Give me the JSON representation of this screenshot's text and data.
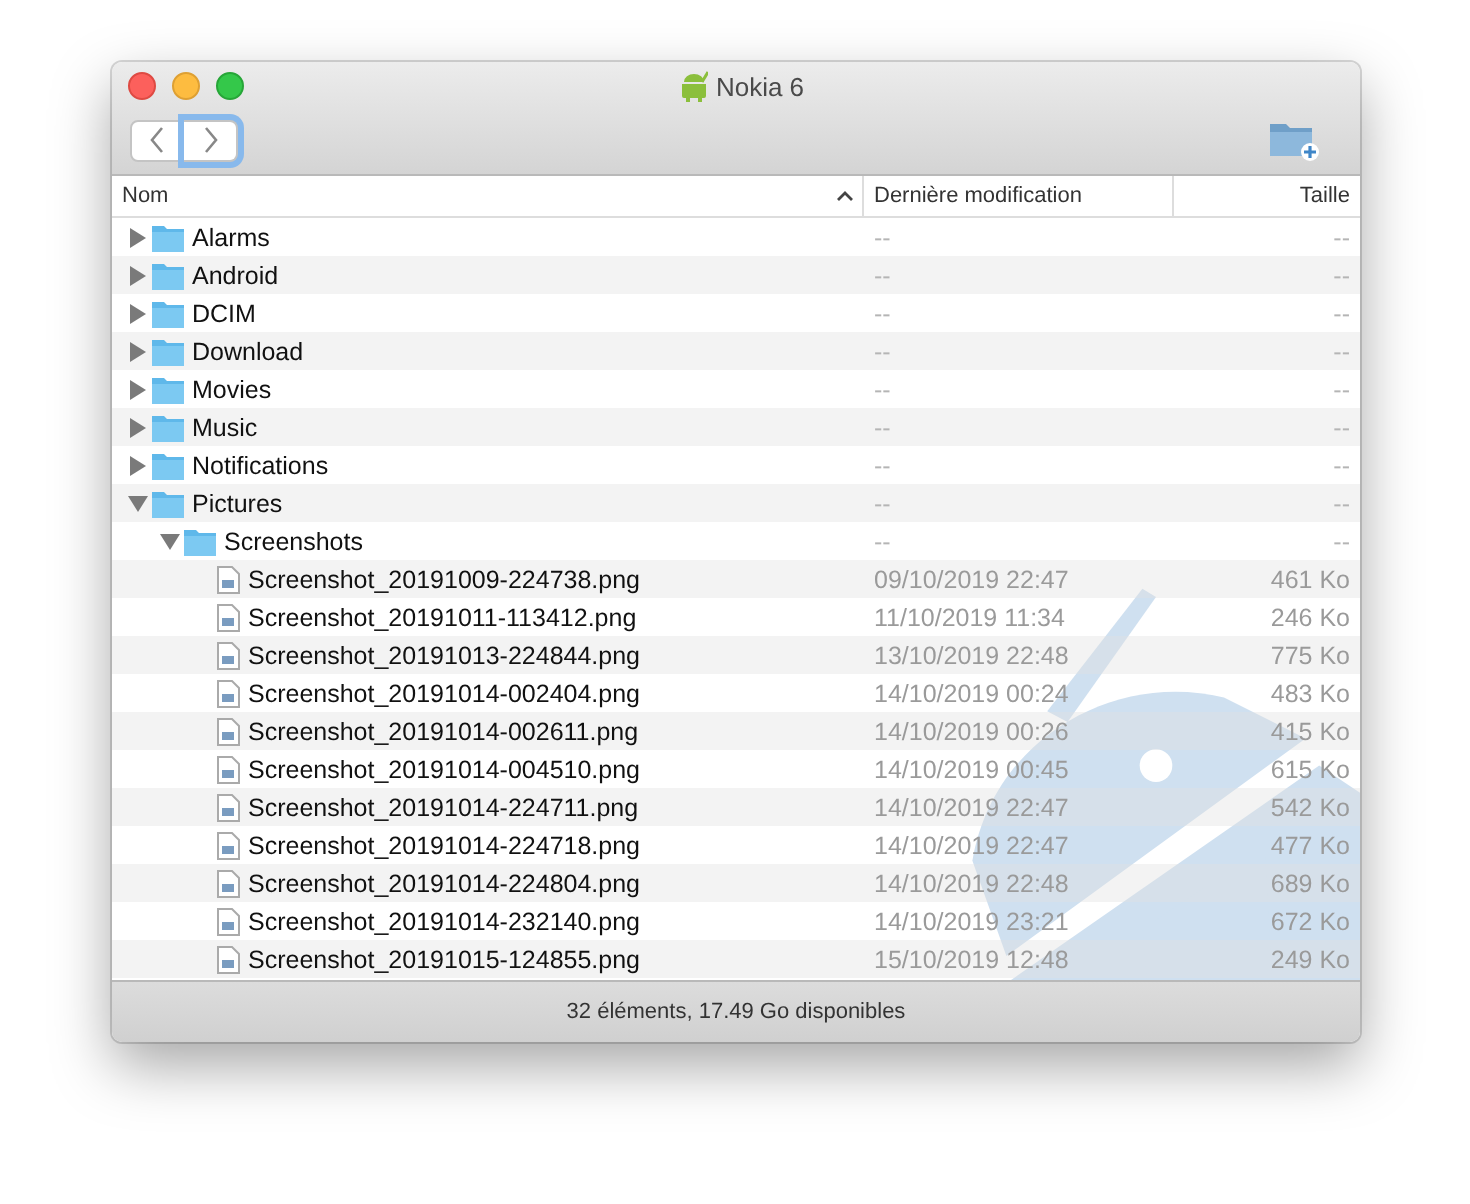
{
  "window": {
    "title": "Nokia 6"
  },
  "nav_buttons": [
    {
      "kind": "back",
      "focused": false
    },
    {
      "kind": "forward",
      "focused": true
    }
  ],
  "columns": [
    {
      "label": "Nom",
      "sorted": true
    },
    {
      "label": "Dernière modification",
      "sorted": false
    },
    {
      "label": "Taille",
      "sorted": false
    }
  ],
  "items": [
    {
      "kind": "folder",
      "name": "Alarms",
      "modified": "--",
      "size": "--",
      "expanded": false
    },
    {
      "kind": "folder",
      "name": "Android",
      "modified": "--",
      "size": "--",
      "expanded": false
    },
    {
      "kind": "folder",
      "name": "DCIM",
      "modified": "--",
      "size": "--",
      "expanded": false
    },
    {
      "kind": "folder",
      "name": "Download",
      "modified": "--",
      "size": "--",
      "expanded": false
    },
    {
      "kind": "folder",
      "name": "Movies",
      "modified": "--",
      "size": "--",
      "expanded": false
    },
    {
      "kind": "folder",
      "name": "Music",
      "modified": "--",
      "size": "--",
      "expanded": false
    },
    {
      "kind": "folder",
      "name": "Notifications",
      "modified": "--",
      "size": "--",
      "expanded": false
    },
    {
      "kind": "folder",
      "name": "Pictures",
      "modified": "--",
      "size": "--",
      "expanded": true,
      "children": [
        {
          "kind": "folder",
          "name": "Screenshots",
          "modified": "--",
          "size": "--",
          "expanded": true,
          "children": [
            {
              "kind": "file",
              "name": "Screenshot_20191009-224738.png",
              "modified": "09/10/2019 22:47",
              "size": "461 Ko"
            },
            {
              "kind": "file",
              "name": "Screenshot_20191011-113412.png",
              "modified": "11/10/2019 11:34",
              "size": "246 Ko"
            },
            {
              "kind": "file",
              "name": "Screenshot_20191013-224844.png",
              "modified": "13/10/2019 22:48",
              "size": "775 Ko"
            },
            {
              "kind": "file",
              "name": "Screenshot_20191014-002404.png",
              "modified": "14/10/2019 00:24",
              "size": "483 Ko"
            },
            {
              "kind": "file",
              "name": "Screenshot_20191014-002611.png",
              "modified": "14/10/2019 00:26",
              "size": "415 Ko"
            },
            {
              "kind": "file",
              "name": "Screenshot_20191014-004510.png",
              "modified": "14/10/2019 00:45",
              "size": "615 Ko"
            },
            {
              "kind": "file",
              "name": "Screenshot_20191014-224711.png",
              "modified": "14/10/2019 22:47",
              "size": "542 Ko"
            },
            {
              "kind": "file",
              "name": "Screenshot_20191014-224718.png",
              "modified": "14/10/2019 22:47",
              "size": "477 Ko"
            },
            {
              "kind": "file",
              "name": "Screenshot_20191014-224804.png",
              "modified": "14/10/2019 22:48",
              "size": "689 Ko"
            },
            {
              "kind": "file",
              "name": "Screenshot_20191014-232140.png",
              "modified": "14/10/2019 23:21",
              "size": "672 Ko"
            },
            {
              "kind": "file",
              "name": "Screenshot_20191015-124855.png",
              "modified": "15/10/2019 12:48",
              "size": "249 Ko"
            }
          ]
        }
      ]
    }
  ],
  "status_bar": "32 éléments, 17.49 Go disponibles"
}
